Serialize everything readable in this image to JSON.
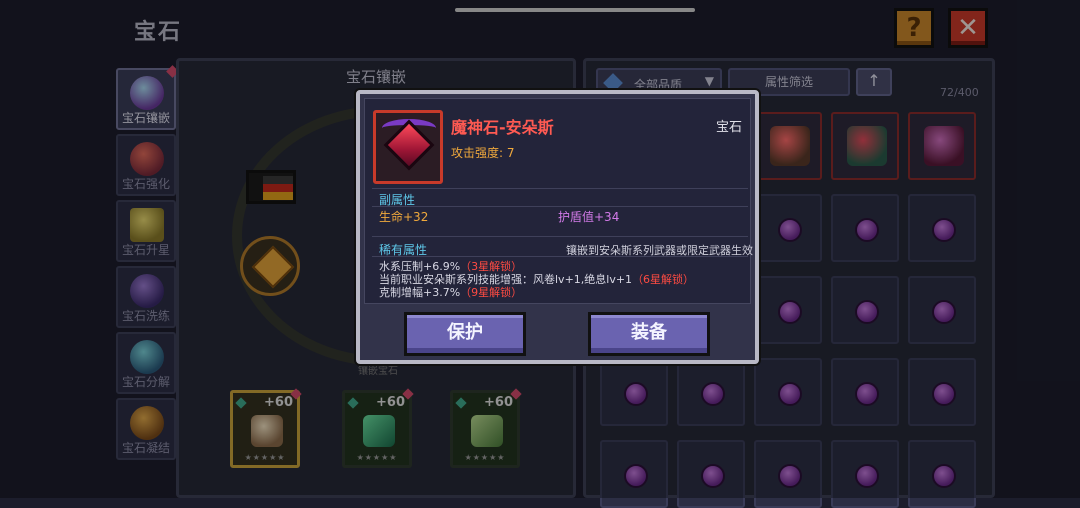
{
  "header": {
    "title": "宝石",
    "help_label": "?",
    "close_label": "✕"
  },
  "tabs": [
    {
      "label": "宝石镶嵌",
      "active": true
    },
    {
      "label": "宝石强化"
    },
    {
      "label": "宝石升星"
    },
    {
      "label": "宝石洗练"
    },
    {
      "label": "宝石分解"
    },
    {
      "label": "宝石凝结"
    }
  ],
  "left_panel": {
    "title": "宝石镶嵌",
    "small_text": "镶嵌宝石",
    "cards": [
      {
        "plus": "+60",
        "stars": "★★★★★",
        "selected": true
      },
      {
        "plus": "+60",
        "stars": "★★★★★"
      },
      {
        "plus": "+60",
        "stars": "★★★★★"
      }
    ]
  },
  "right_panel": {
    "quality_filter": "全部品质",
    "attr_filter": "属性筛选",
    "sort_icon": "↑",
    "count": "72/400"
  },
  "popup": {
    "item_name": "魔神石-安朵斯",
    "item_type": "宝石",
    "attack": "攻击强度: 7",
    "sub_attr_header": "副属性",
    "sub_attrs": {
      "hp": "生命+32",
      "shield": "护盾值+34"
    },
    "rare_header": "稀有属性",
    "rare_note": "镶嵌到安朵斯系列武器或限定武器生效",
    "rare_lines": [
      {
        "text": "水系压制+6.9%",
        "lock": "（3星解锁）"
      },
      {
        "text": "当前职业安朵斯系列技能增强：风卷lv+1,绝息lv+1",
        "lock": "（6星解锁）"
      },
      {
        "text": "克制增幅+3.7%",
        "lock": "（9星解锁）"
      }
    ],
    "protect_label": "保护",
    "equip_label": "装备"
  },
  "colors": {
    "rarity_red": "#ff5a52",
    "sub_attr_blue": "#5ec7e8",
    "stat_orange": "#f0a93c",
    "stat_purple": "#d27ae8",
    "button_purple": "#6a63b0"
  }
}
